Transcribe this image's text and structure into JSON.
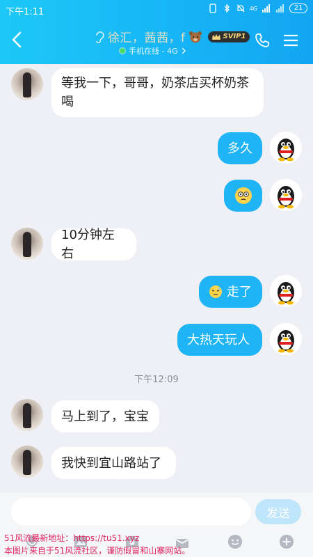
{
  "status_bar": {
    "time": "下午1:11",
    "network": "4G",
    "battery": "21"
  },
  "header": {
    "title": "徐汇，茜茜，f",
    "vip_badge": "SVIP1",
    "subtitle": "手机在线 - 4G"
  },
  "messages": [
    {
      "side": "left",
      "text": "等我一下，哥哥，奶茶店买杯奶茶喝"
    },
    {
      "side": "right",
      "text": "多久"
    },
    {
      "side": "right",
      "text": "",
      "emoji": "confused-face"
    },
    {
      "side": "left",
      "text": "10分钟左右"
    },
    {
      "side": "right",
      "text": "走了",
      "emoji": "sweat-face"
    },
    {
      "side": "right",
      "text": "大热天玩人"
    },
    {
      "side": "left",
      "text": "马上到了，宝宝"
    },
    {
      "side": "left",
      "text": "我快到宜山路站了"
    }
  ],
  "timestamp": "下午12:09",
  "message_lines": {
    "m0_line1": "等我一下，哥哥，奶茶店买杯奶茶",
    "m0_line2": "喝"
  },
  "input": {
    "value": "",
    "placeholder": ""
  },
  "send_label": "发送",
  "watermark": {
    "line1": "51风流最新地址：https://tu51.xyz",
    "line2": "本图片来自于51风流社区，谨防假冒和山寨网站。"
  },
  "icons": [
    "back-icon",
    "ear-icon",
    "bear-icon",
    "phone-icon",
    "menu-icon",
    "emoji-icon",
    "plus-icon",
    "image-icon",
    "camera-icon",
    "mic-icon",
    "gift-icon"
  ]
}
